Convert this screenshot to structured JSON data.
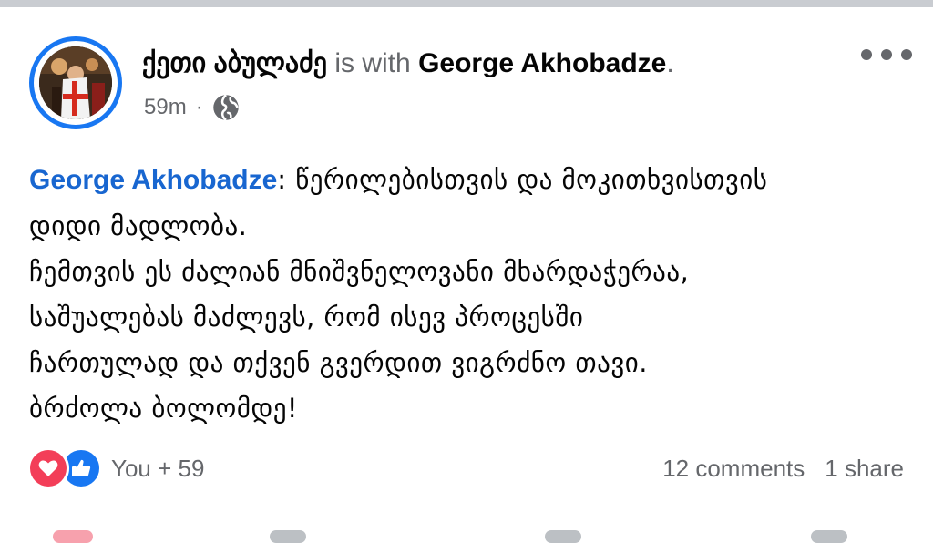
{
  "post": {
    "author": "ქეთი აბულაძე",
    "with_text": "is with",
    "tagged_user": "George Akhobadze",
    "tagged_suffix": ".",
    "time": "59m",
    "separator": "·",
    "privacy_icon": "globe-icon",
    "more_icon": "more-horizontal-icon"
  },
  "content": {
    "mention": "George Akhobadze",
    "mention_suffix": ": ",
    "line1_rest": "წერილებისთვის და მოკითხვისთვის",
    "lines": [
      "დიდი მადლობა.",
      "ჩემთვის ეს ძალიან მნიშვნელოვანი მხარდაჭერაა,",
      "საშუალებას მაძლევს, რომ ისევ პროცესში",
      "ჩართულად და თქვენ გვერდით ვიგრძნო თავი.",
      "ბრძოლა ბოლომდე!"
    ]
  },
  "reactions": {
    "icons": [
      "heart-icon",
      "like-icon"
    ],
    "summary": "You + 59"
  },
  "stats": {
    "comments": "12 comments",
    "shares": "1 share"
  },
  "colors": {
    "accent": "#1877f2",
    "mention": "#1866d0",
    "secondary_text": "#65676b",
    "love": "#f33e58"
  }
}
